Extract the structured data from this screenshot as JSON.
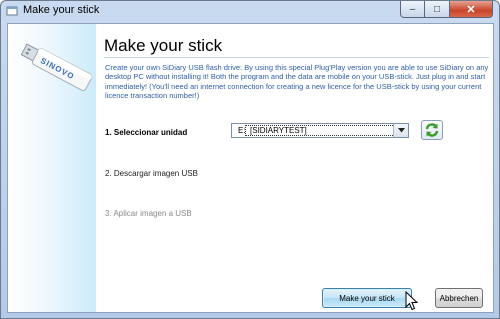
{
  "window": {
    "title": "Make your stick",
    "minimize_glyph": "–",
    "maximize_glyph": "□",
    "close_glyph": "✕"
  },
  "sidebar": {
    "logo_text": "SINOVO",
    "image": "usb-stick-icon"
  },
  "main": {
    "title": "Make your stick",
    "description": "Create your own SiDiary USB flash drive: By using this special Plug'Play version you are able to use SiDiary on any desktop PC without installing it! Both the program and the data are mobile on your USB-stick. Just plug in and start immediately! (You'll need an internet connection for creating a new licence for the USB-stick by using your current licence transaction number!)",
    "steps": [
      {
        "label": "1. Seleccionar unidad",
        "state": "active"
      },
      {
        "label": "2. Descargar imagen USB",
        "state": "enabled"
      },
      {
        "label": "3. Aplicar imagen a USB",
        "state": "disabled"
      }
    ],
    "drive_select": {
      "value": "E:  [SIDIARYTEST]"
    },
    "refresh_icon": "refresh-icon"
  },
  "footer": {
    "make_button": "Make your stick",
    "cancel_button": "Abbrechen"
  },
  "colors": {
    "description_text": "#2f5fa8",
    "refresh_green": "#3a9a2a",
    "close_red": "#c7452a"
  }
}
